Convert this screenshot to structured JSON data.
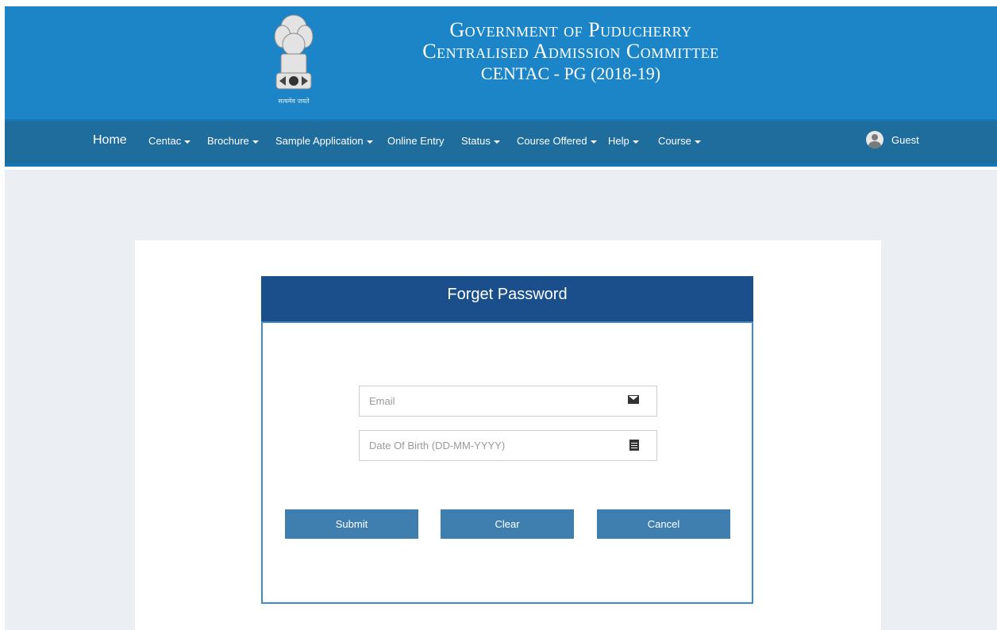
{
  "header": {
    "title_line1": "Government of Puducherry",
    "title_line2": "Centralised Admission Committee",
    "title_line3": "CENTAC - PG (2018-19)",
    "emblem_motto": "सत्यमेव जयते"
  },
  "nav": {
    "items": [
      {
        "label": "Home",
        "dropdown": false
      },
      {
        "label": "Centac",
        "dropdown": true
      },
      {
        "label": "Brochure",
        "dropdown": true
      },
      {
        "label": "Sample Application",
        "dropdown": true
      },
      {
        "label": "Online Entry",
        "dropdown": false
      },
      {
        "label": "Status",
        "dropdown": true
      },
      {
        "label": "Course Offered",
        "dropdown": true
      },
      {
        "label": "Help",
        "dropdown": true
      },
      {
        "label": "Course",
        "dropdown": true
      }
    ],
    "user": "Guest"
  },
  "form": {
    "title": "Forget Password",
    "email_placeholder": "Email",
    "email_value": "",
    "dob_placeholder": "Date Of Birth (DD-MM-YYYY)",
    "dob_value": ""
  },
  "buttons": {
    "submit": "Submit",
    "clear": "Clear",
    "cancel": "Cancel"
  },
  "colors": {
    "header_bg": "#1b85c7",
    "nav_bg": "#1e6d9c",
    "panel_head": "#1b4f8c",
    "button": "#3e7faf"
  },
  "icons": {
    "email": "envelope-icon",
    "dob": "calendar-icon",
    "user": "user-avatar-icon"
  }
}
